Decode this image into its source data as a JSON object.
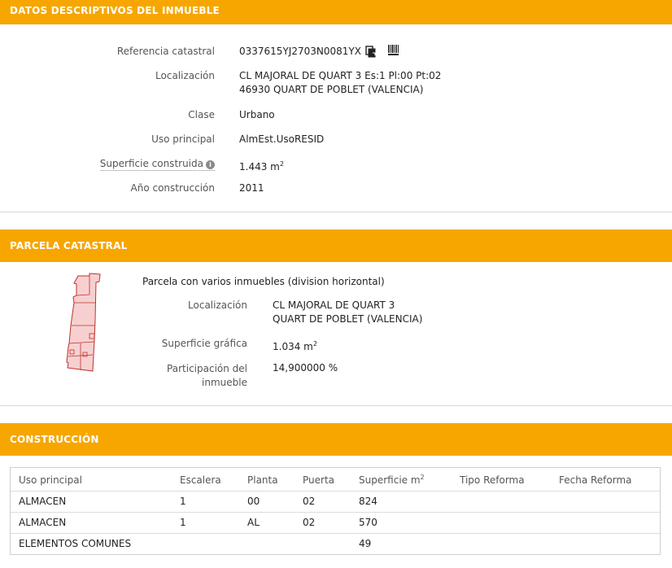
{
  "sections": {
    "descriptive_title": "DATOS DESCRIPTIVOS DEL INMUEBLE",
    "parcel_title": "PARCELA CATASTRAL",
    "construction_title": "CONSTRUCCIÓN"
  },
  "inmueble": {
    "ref_label": "Referencia catastral",
    "ref_value": "0337615YJ2703N0081YX",
    "loc_label": "Localización",
    "loc_line1": "CL MAJORAL DE QUART 3 Es:1 Pl:00 Pt:02",
    "loc_line2": "46930 QUART DE POBLET (VALENCIA)",
    "clase_label": "Clase",
    "clase_value": "Urbano",
    "uso_label": "Uso principal",
    "uso_value": "AlmEst.UsoRESID",
    "sup_label": "Superficie construida",
    "sup_value": "1.443 m",
    "sup_unit_exp": "2",
    "anio_label": "Año construcción",
    "anio_value": "2011"
  },
  "parcela": {
    "subtitle": "Parcela con varios inmuebles (division horizontal)",
    "loc_label": "Localización",
    "loc_line1": "CL MAJORAL DE QUART 3",
    "loc_line2": "QUART DE POBLET (VALENCIA)",
    "sup_label": "Superficie gráfica",
    "sup_value": "1.034 m",
    "sup_unit_exp": "2",
    "part_label_line1": "Participación del",
    "part_label_line2": "inmueble",
    "part_value": "14,900000 %"
  },
  "construccion": {
    "headers": [
      "Uso principal",
      "Escalera",
      "Planta",
      "Puerta",
      "Superficie m",
      "Tipo Reforma",
      "Fecha Reforma"
    ],
    "superficie_exp": "2",
    "rows": [
      [
        "ALMACEN",
        "1",
        "00",
        "02",
        "824",
        "",
        ""
      ],
      [
        "ALMACEN",
        "1",
        "AL",
        "02",
        "570",
        "",
        ""
      ],
      [
        "ELEMENTOS COMUNES",
        "",
        "",
        "",
        "49",
        "",
        ""
      ]
    ]
  },
  "icons": {
    "copy": "copy-icon",
    "barcode": "barcode-icon",
    "info": "info-icon",
    "info_glyph": "i"
  },
  "colors": {
    "header_bg": "#f7a600",
    "parcel_fill": "#f6d0d0",
    "parcel_stroke": "#c0302a"
  }
}
